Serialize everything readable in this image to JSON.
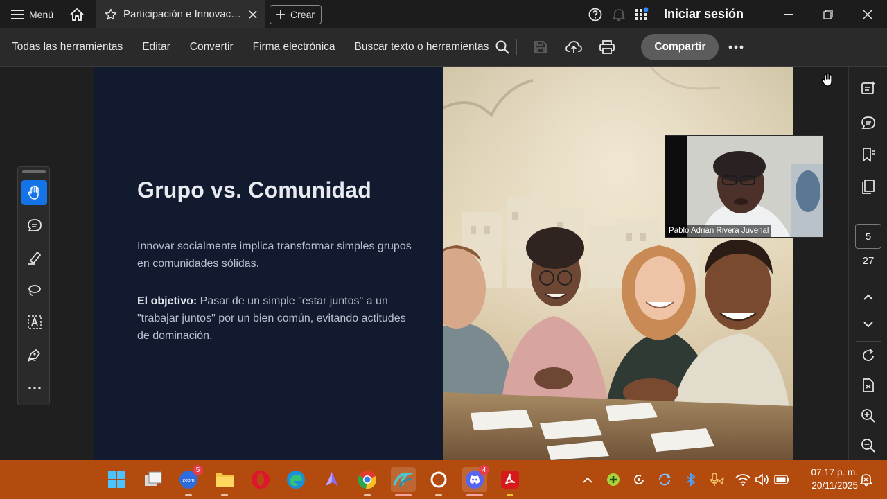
{
  "titlebar": {
    "menu_label": "Menú",
    "tab_title": "Participación e Innovación Social",
    "create_label": "Crear",
    "signin_label": "Iniciar sesión"
  },
  "toolbar": {
    "all_tools": "Todas las herramientas",
    "edit": "Editar",
    "convert": "Convertir",
    "esign": "Firma electrónica",
    "search_label": "Buscar texto o herramientas",
    "share_label": "Compartir"
  },
  "slide": {
    "title": "Grupo vs. Comunidad",
    "paragraph1": "Innovar socialmente implica transformar simples grupos en comunidades sólidas.",
    "objective_label": "El objetivo:",
    "objective_text": " Pasar de un simple \"estar juntos\" a un \"trabajar juntos\" por un bien común, evitando actitudes de dominación."
  },
  "video": {
    "participant_name": "Pablo Adrian Rivera Juvenal"
  },
  "pagination": {
    "current_page": "5",
    "total_pages": "27"
  },
  "taskbar": {
    "zoom_badge": "5",
    "discord_badge": "4",
    "time": "07:17 p. m.",
    "date": "20/11/2025"
  },
  "colors": {
    "accent_blue": "#1473e6",
    "slide_navy": "#121a30",
    "taskbar_orange": "#b34a0e",
    "acrobat_red": "#d7191c"
  },
  "icons": {
    "left_rail": [
      "hand-icon",
      "comment-icon",
      "highlight-icon",
      "lasso-icon",
      "text-box-icon",
      "sign-icon",
      "more-icon"
    ],
    "right_rail": [
      "ai-assistant-icon",
      "comments-panel-icon",
      "bookmarks-icon",
      "pages-icon",
      "chevron-up-icon",
      "chevron-down-icon",
      "refresh-icon",
      "page-info-icon",
      "zoom-in-icon",
      "zoom-out-icon"
    ]
  }
}
